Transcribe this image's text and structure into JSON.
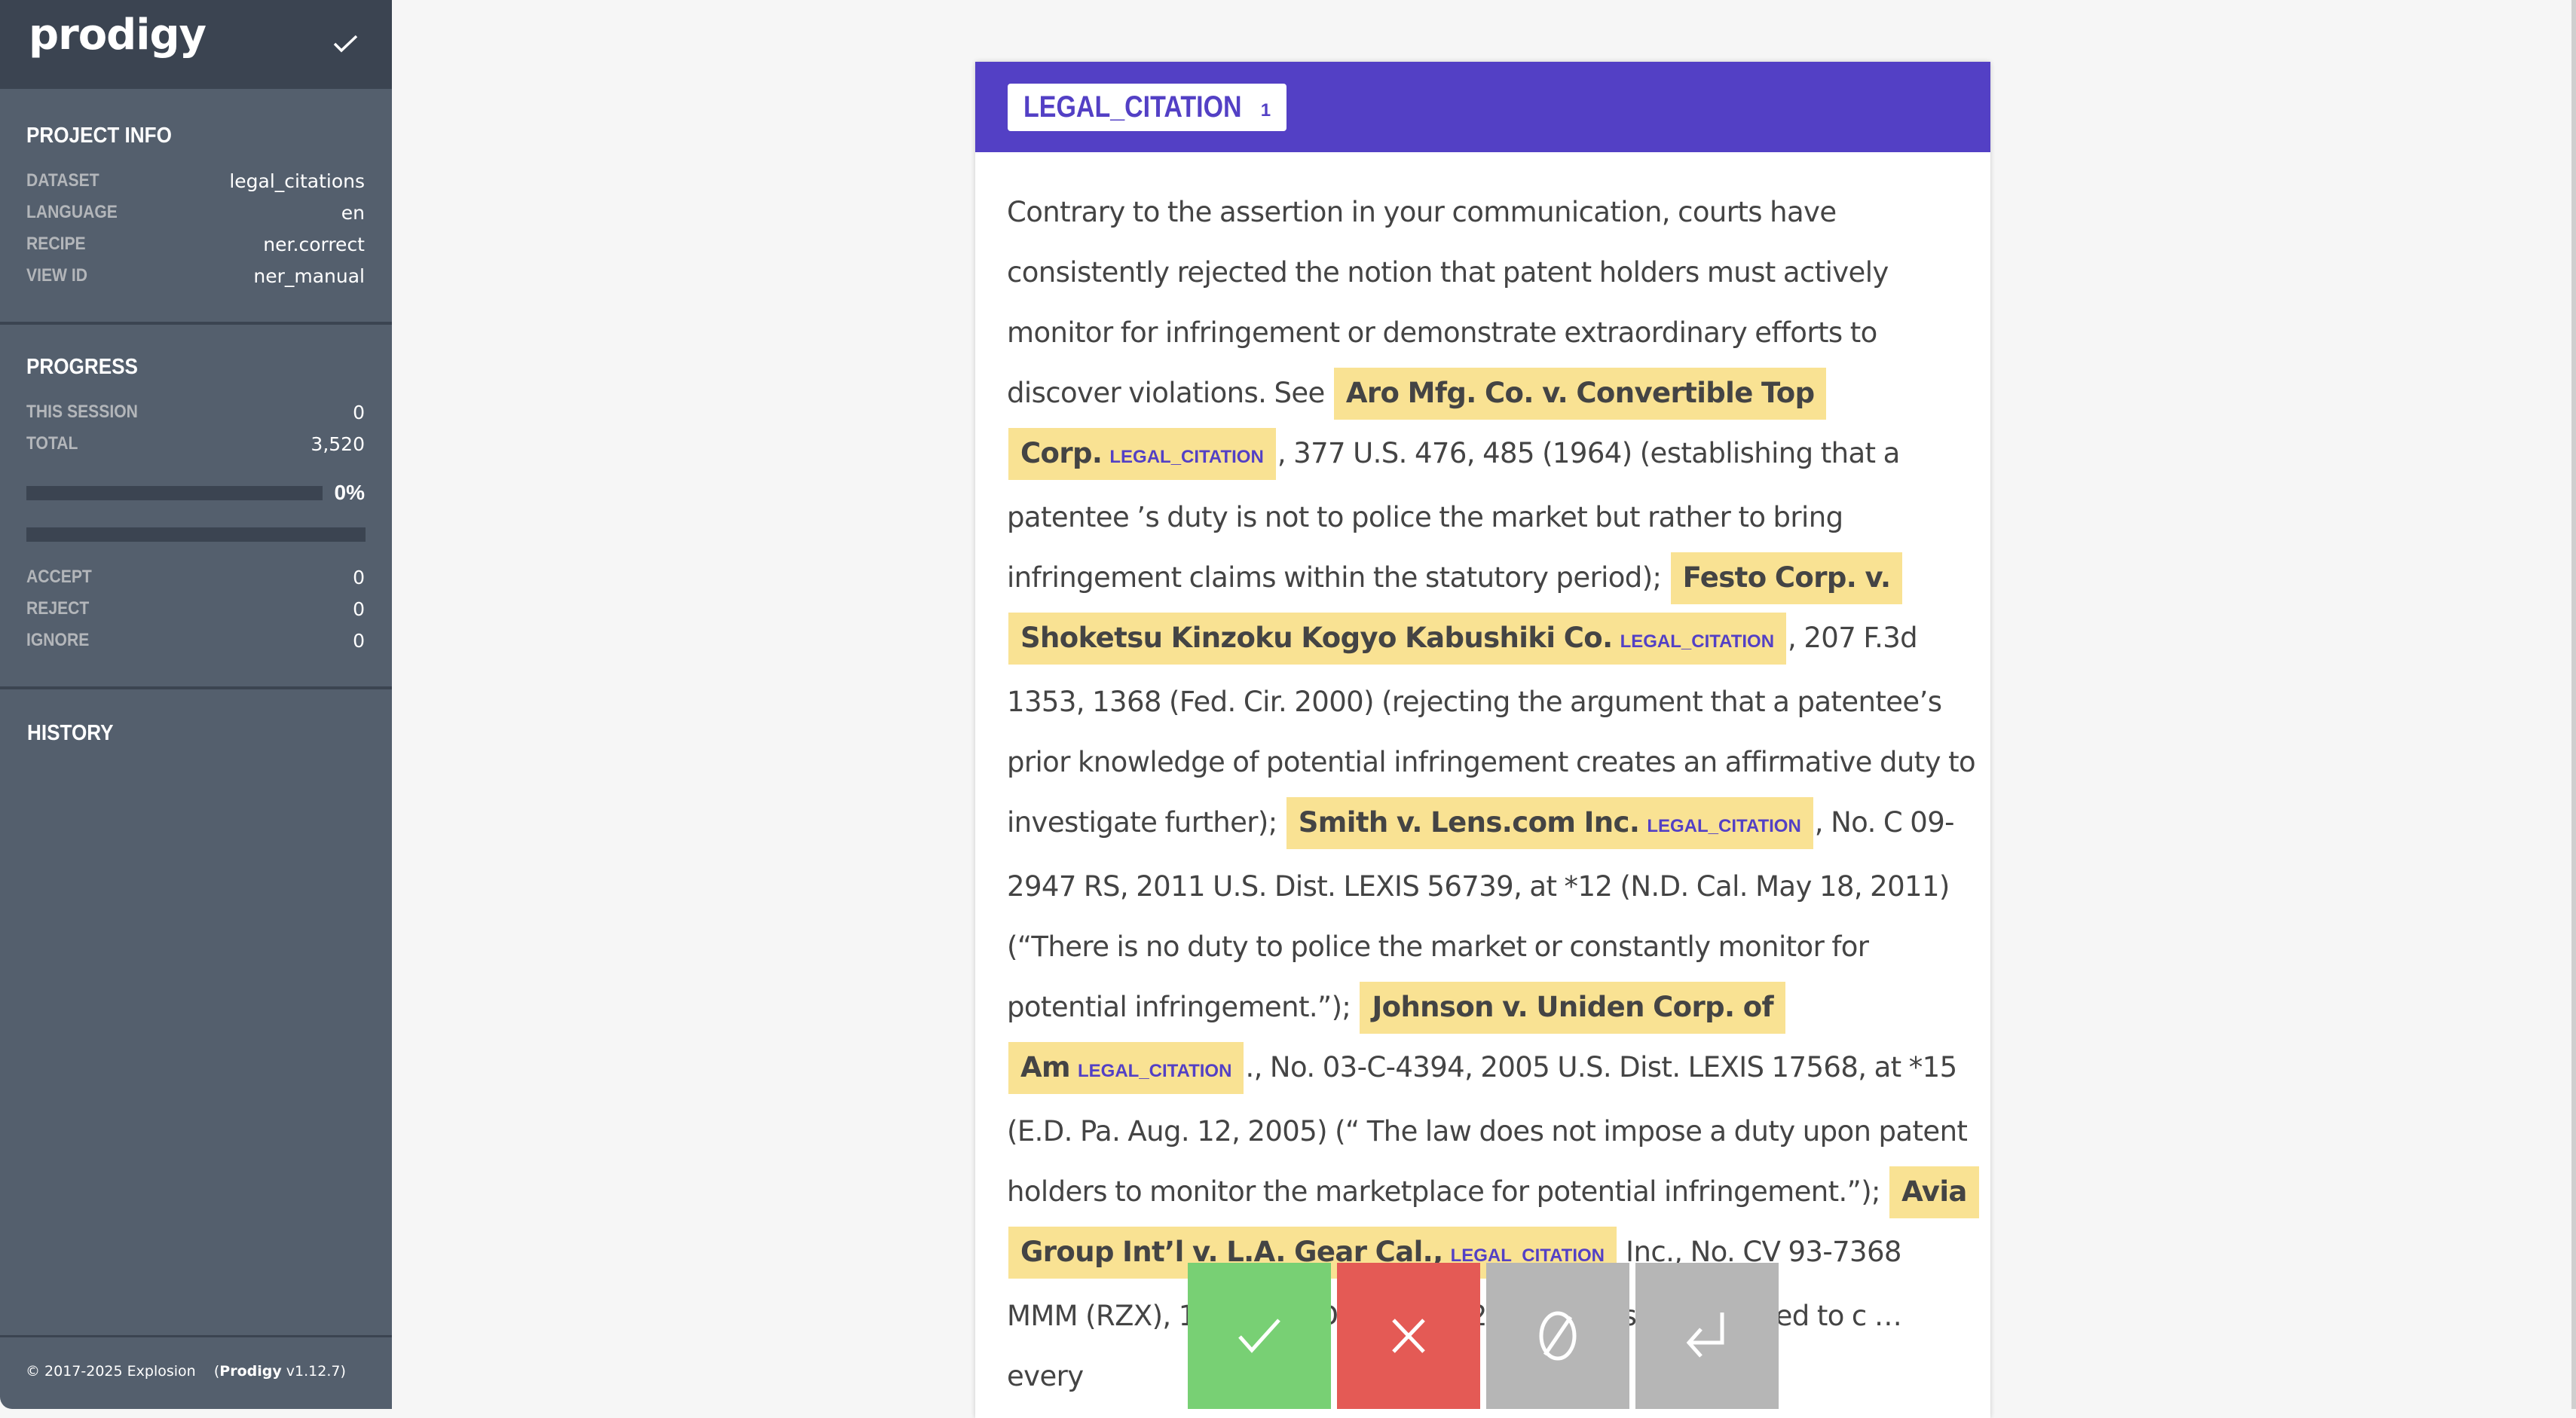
{
  "app": {
    "logo": "prodigy",
    "status_icon": "check-icon"
  },
  "sidebar": {
    "project_info": {
      "title": "PROJECT INFO",
      "rows": [
        {
          "label": "DATASET",
          "value": "legal_citations"
        },
        {
          "label": "LANGUAGE",
          "value": "en"
        },
        {
          "label": "RECIPE",
          "value": "ner.correct"
        },
        {
          "label": "VIEW ID",
          "value": "ner_manual"
        }
      ]
    },
    "progress": {
      "title": "PROGRESS",
      "this_session_label": "THIS SESSION",
      "this_session": "0",
      "total_label": "TOTAL",
      "total": "3,520",
      "percent": 0,
      "percent_label": "0%",
      "counts": [
        {
          "label": "ACCEPT",
          "value": "0"
        },
        {
          "label": "REJECT",
          "value": "0"
        },
        {
          "label": "IGNORE",
          "value": "0"
        }
      ]
    },
    "history": {
      "title": "HISTORY"
    },
    "footer": {
      "copyright": "© 2017-2025 Explosion",
      "product": "Prodigy",
      "version": "v1.12.7"
    }
  },
  "card": {
    "labels": [
      {
        "name": "LEGAL_CITATION",
        "key": "1",
        "color": "#5340c5"
      }
    ],
    "highlight_color": "#f9e293",
    "segments": [
      {
        "t": "Contrary to the assertion in your communication, courts have consistently rejected the notion that patent holders must actively monitor for infringement or demonstrate extraordinary efforts to discover violations. See "
      },
      {
        "e": "Aro Mfg. Co. v. Convertible Top Corp.",
        "label": "LEGAL_CITATION"
      },
      {
        "t": ", 377 U.S. 476, 485 (1964) (establishing that a patentee ’s duty is not to police the market but rather to bring infringement claims within the statutory period); "
      },
      {
        "e": "Festo Corp. v. Shoketsu Kinzoku Kogyo Kabushiki Co.",
        "label": "LEGAL_CITATION"
      },
      {
        "t": ", 207 F.3d 1353, 1368 (Fed. Cir. 2000) (rejecting the argument that a patentee’s prior knowledge of potential infringement creates an affirmative duty to investigate further); "
      },
      {
        "e": "Smith v. Lens.com Inc.",
        "label": "LEGAL_CITATION"
      },
      {
        "t": ", No. C 09-2947 RS, 2011 U.S. Dist. LEXIS 56739, at *12 (N.D. Cal. May 18, 2011) (“There is no duty to police the market or constantly monitor for potential infringement.”); "
      },
      {
        "e": "Johnson v. Uniden Corp. of Am",
        "label": "LEGAL_CITATION"
      },
      {
        "t": "., No. 03-C-4394, 2005 U.S. Dist. LEXIS 17568, at *15 (E.D. Pa. Aug. 12, 2005) (“ The law does not impose a duty upon patent holders to monitor the marketplace for potential infringement.”); "
      },
      {
        "e": "Avia Group Int’l v. L.A. Gear Cal.,",
        "label": "LEGAL_CITATION"
      },
      {
        "t": " Inc., No. CV 93-7368 MMM (RZX), 1994 U.S. Dist. LEXIS 2 … entee is not required to c … every"
      }
    ]
  },
  "actions": [
    {
      "name": "accept",
      "icon": "check-icon",
      "color": "#78d074"
    },
    {
      "name": "reject",
      "icon": "x-icon",
      "color": "#e45a55"
    },
    {
      "name": "ignore",
      "icon": "ignore-icon",
      "color": "#b6b6b6"
    },
    {
      "name": "undo",
      "icon": "undo-icon",
      "color": "#b6b6b6"
    }
  ]
}
